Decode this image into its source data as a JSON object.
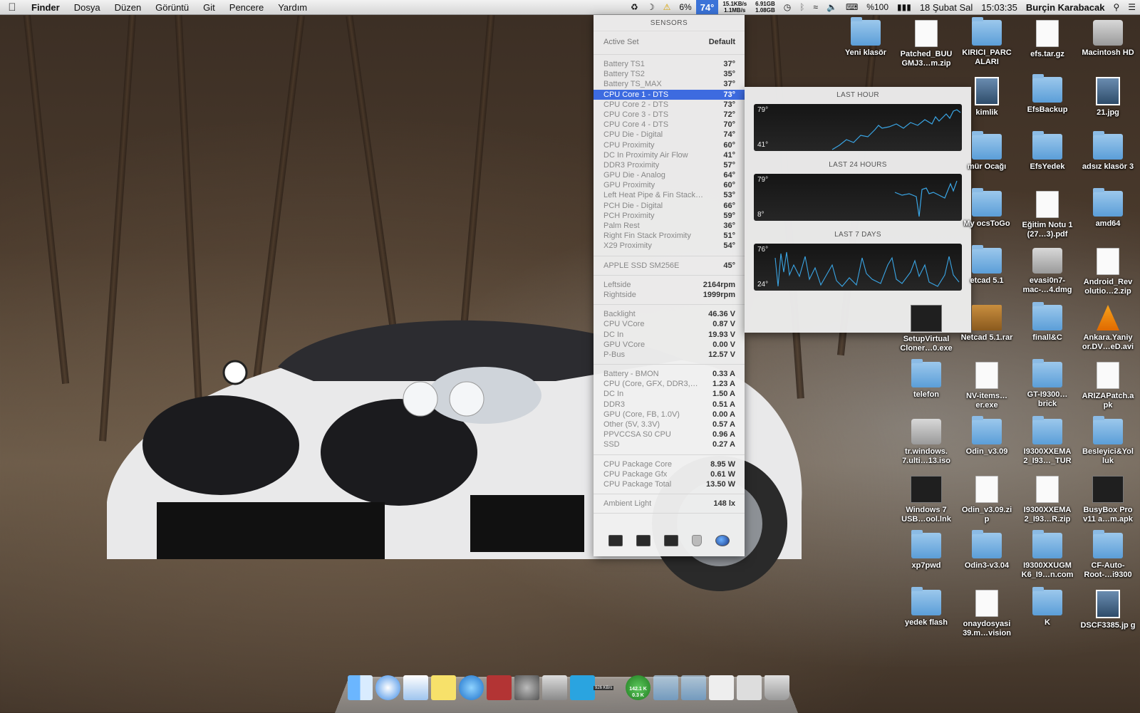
{
  "menubar": {
    "app": "Finder",
    "menus": [
      "Dosya",
      "Düzen",
      "Görüntü",
      "Git",
      "Pencere",
      "Yardım"
    ],
    "cpu_percent": "6%",
    "temperature": "74°",
    "net_up": "15.1KB/s",
    "net_down": "1.1MB/s",
    "disk_used": "6.91GB",
    "disk_free": "1.08GB",
    "battery": "%100",
    "date": "18 Şubat Sal",
    "time": "15:03:35",
    "user": "Burçin Karabacak"
  },
  "sensors": {
    "header": "SENSORS",
    "active_set_label": "Active Set",
    "active_set_value": "Default",
    "temps": [
      {
        "label": "Battery TS1",
        "value": "37°"
      },
      {
        "label": "Battery TS2",
        "value": "35°"
      },
      {
        "label": "Battery TS_MAX",
        "value": "37°"
      },
      {
        "label": "CPU Core 1 - DTS",
        "value": "73°"
      },
      {
        "label": "CPU Core 2 - DTS",
        "value": "73°"
      },
      {
        "label": "CPU Core 3 - DTS",
        "value": "72°"
      },
      {
        "label": "CPU Core 4 - DTS",
        "value": "70°"
      },
      {
        "label": "CPU Die - Digital",
        "value": "74°"
      },
      {
        "label": "CPU Proximity",
        "value": "60°"
      },
      {
        "label": "DC In Proximity Air Flow",
        "value": "41°"
      },
      {
        "label": "DDR3 Proximity",
        "value": "57°"
      },
      {
        "label": "GPU Die - Analog",
        "value": "64°"
      },
      {
        "label": "GPU Proximity",
        "value": "60°"
      },
      {
        "label": "Left Heat Pipe & Fin Stack…",
        "value": "53°"
      },
      {
        "label": "PCH Die - Digital",
        "value": "66°"
      },
      {
        "label": "PCH Proximity",
        "value": "59°"
      },
      {
        "label": "Palm Rest",
        "value": "36°"
      },
      {
        "label": "Right Fin Stack Proximity",
        "value": "51°"
      },
      {
        "label": "X29 Proximity",
        "value": "54°"
      }
    ],
    "ssd": [
      {
        "label": "APPLE SSD SM256E",
        "value": "45°"
      }
    ],
    "fans": [
      {
        "label": "Leftside",
        "value": "2164rpm"
      },
      {
        "label": "Rightside",
        "value": "1999rpm"
      }
    ],
    "voltages": [
      {
        "label": "Backlight",
        "value": "46.36 V"
      },
      {
        "label": "CPU VCore",
        "value": "0.87 V"
      },
      {
        "label": "DC In",
        "value": "19.93 V"
      },
      {
        "label": "GPU VCore",
        "value": "0.00 V"
      },
      {
        "label": "P-Bus",
        "value": "12.57 V"
      }
    ],
    "currents": [
      {
        "label": "Battery - BMON",
        "value": "0.33 A"
      },
      {
        "label": "CPU (Core, GFX, DDR3,…",
        "value": "1.23 A"
      },
      {
        "label": "DC In",
        "value": "1.50 A"
      },
      {
        "label": "DDR3",
        "value": "0.51 A"
      },
      {
        "label": "GPU (Core, FB, 1.0V)",
        "value": "0.00 A"
      },
      {
        "label": "Other (5V, 3.3V)",
        "value": "0.57 A"
      },
      {
        "label": "PPVCCSA S0 CPU",
        "value": "0.96 A"
      },
      {
        "label": "SSD",
        "value": "0.27 A"
      }
    ],
    "power": [
      {
        "label": "CPU Package Core",
        "value": "8.95 W"
      },
      {
        "label": "CPU Package Gfx",
        "value": "0.61 W"
      },
      {
        "label": "CPU Package Total",
        "value": "13.50 W"
      }
    ],
    "light": [
      {
        "label": "Ambient Light",
        "value": "148 lx"
      }
    ]
  },
  "graphs": [
    {
      "title": "LAST HOUR",
      "max": "79°",
      "min": "41°"
    },
    {
      "title": "LAST 24 HOURS",
      "max": "79°",
      "min": "8°"
    },
    {
      "title": "LAST 7 DAYS",
      "max": "76°",
      "min": "24°"
    }
  ],
  "desktop_icons": [
    {
      "label": "Yeni klasör",
      "kind": "folder"
    },
    {
      "label": "Patched_BUU GMJ3…m.zip",
      "kind": "file"
    },
    {
      "label": "KIRICI_PARC ALARI",
      "kind": "folder"
    },
    {
      "label": "efs.tar.gz",
      "kind": "file"
    },
    {
      "label": "Macintosh HD",
      "kind": "disk"
    },
    {
      "label": "kimlik",
      "kind": "photo"
    },
    {
      "label": "EfsBackup",
      "kind": "folder"
    },
    {
      "label": "21.jpg",
      "kind": "photo"
    },
    {
      "label": "mür Ocağı",
      "kind": "folder"
    },
    {
      "label": "EfsYedek",
      "kind": "folder"
    },
    {
      "label": "adsız klasör 3",
      "kind": "folder"
    },
    {
      "label": "My ocsToGo",
      "kind": "folder"
    },
    {
      "label": "Eğitim Notu 1 (27…3).pdf",
      "kind": "file"
    },
    {
      "label": "amd64",
      "kind": "folder"
    },
    {
      "label": "etcad 5.1",
      "kind": "folder"
    },
    {
      "label": "evasi0n7-mac-…4.dmg",
      "kind": "disk"
    },
    {
      "label": "Android_Rev olutio…2.zip",
      "kind": "file"
    },
    {
      "label": "SetupVirtual Cloner…0.exe",
      "kind": "dark"
    },
    {
      "label": "Netcad 5.1.rar",
      "kind": "rar"
    },
    {
      "label": "finall&C",
      "kind": "folder"
    },
    {
      "label": "Ankara.Yaniy or.DV…eD.avi",
      "kind": "vlc"
    },
    {
      "label": "telefon",
      "kind": "folder"
    },
    {
      "label": "NV-items…er.exe",
      "kind": "file"
    },
    {
      "label": "GT-I9300…brick",
      "kind": "folder"
    },
    {
      "label": "ARIZAPatch.a pk",
      "kind": "file"
    },
    {
      "label": "tr.windows. 7.ulti…13.iso",
      "kind": "disk"
    },
    {
      "label": "Odin_v3.09",
      "kind": "folder"
    },
    {
      "label": "I9300XXEMA 2_I93…_TUR",
      "kind": "folder"
    },
    {
      "label": "Besleyici&Yol luk",
      "kind": "folder"
    },
    {
      "label": "Windows 7 USB…ool.lnk",
      "kind": "dark"
    },
    {
      "label": "Odin_v3.09.zi p",
      "kind": "file"
    },
    {
      "label": "I9300XXEMA 2_I93…R.zip",
      "kind": "file"
    },
    {
      "label": "BusyBox Pro v11 a…m.apk",
      "kind": "dark"
    },
    {
      "label": "xp7pwd",
      "kind": "folder"
    },
    {
      "label": "Odin3-v3.04",
      "kind": "folder"
    },
    {
      "label": "I9300XXUGM K6_I9…n.com",
      "kind": "folder"
    },
    {
      "label": "CF-Auto-Root-…i9300",
      "kind": "folder"
    },
    {
      "label": "yedek flash",
      "kind": "folder"
    },
    {
      "label": "onaydosyasi 39.m…vision",
      "kind": "file"
    },
    {
      "label": "K",
      "kind": "folder"
    },
    {
      "label": "DSCF3385.jp g",
      "kind": "photo"
    }
  ],
  "dock": {
    "net_badge_up": "142.1 K",
    "net_badge_down": "0.3 K",
    "small_badge": "926 KB/s"
  },
  "colors": {
    "selection": "#3d6be0",
    "graph_line": "#3aa6e6",
    "temp_status": "#3b73d8"
  }
}
